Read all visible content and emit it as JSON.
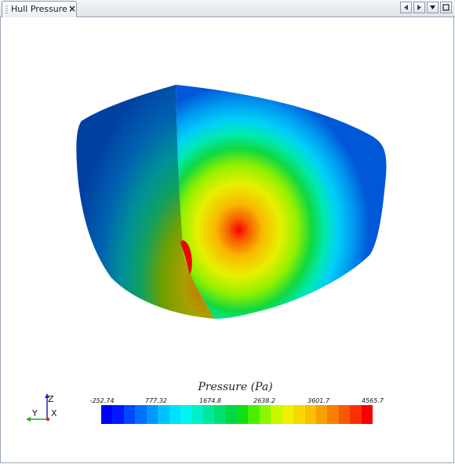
{
  "tab": {
    "title": "Hull Pressure",
    "close": "×"
  },
  "nav": {
    "prev": "◀",
    "next": "▶",
    "menu": "▼",
    "maximize": "□"
  },
  "scalar_bar": {
    "title": "Pressure (Pa)",
    "ticks": [
      "-252.74",
      "777.32",
      "1674.8",
      "2638.2",
      "3601.7",
      "4565.7"
    ],
    "colors": [
      "#0000ff",
      "#0018ff",
      "#0048ff",
      "#0070ff",
      "#0098ff",
      "#00c0ff",
      "#00e0ff",
      "#00f4f0",
      "#00f0c8",
      "#00e8a0",
      "#00e070",
      "#00d848",
      "#10e010",
      "#48f000",
      "#88f800",
      "#c8f800",
      "#f0f000",
      "#f8d800",
      "#f8c000",
      "#f8a000",
      "#f88000",
      "#f85800",
      "#f83000",
      "#f80000"
    ]
  },
  "axes": {
    "z": "Z",
    "y": "Y",
    "x": "X"
  }
}
